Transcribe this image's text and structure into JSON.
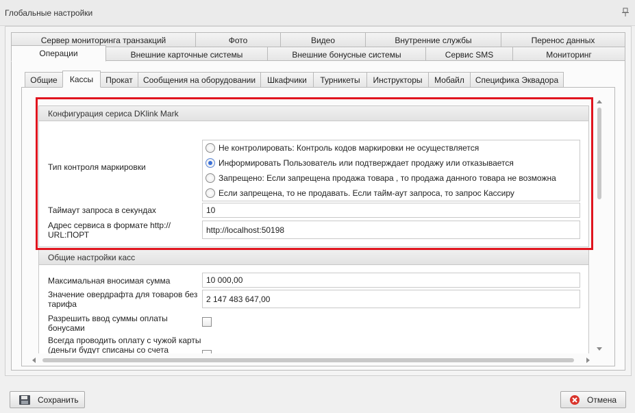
{
  "window": {
    "title": "Глобальные настройки",
    "pin_icon": "pin-icon"
  },
  "tabs_row1": [
    "Сервер мониторинга транзакций",
    "Фото",
    "Видео",
    "Внутренние службы",
    "Перенос данных"
  ],
  "tabs_row2": [
    "Операции",
    "Внешние карточные системы",
    "Внешние бонусные системы",
    "Сервис SMS",
    "Мониторинг"
  ],
  "tabs_row2_active": "Операции",
  "subtabs": [
    "Общие",
    "Кассы",
    "Прокат",
    "Сообщения на оборудовании",
    "Шкафчики",
    "Турникеты",
    "Инструкторы",
    "Мобайл",
    "Специфика Эквадора"
  ],
  "subtabs_active": "Кассы",
  "dklink": {
    "header": "Конфигурация сериса DKlink Mark",
    "control_type_label": "Тип контроля маркировки",
    "options": [
      "Не контролировать: Контроль кодов маркировки не  осуществляется",
      "Информировать Пользователь или подтверждает продажу или отказывается",
      "Запрещено: Если запрещена продажа товара , то продажа данного товара не возможна",
      "Если запрещена, то не продавать. Если тайм-аут запроса, то запрос Кассиру"
    ],
    "selected_option": "Информировать Пользователь или подтверждает продажу или отказывается",
    "timeout_label": "Таймаут запроса в секундах",
    "timeout_value": "10",
    "address_label_line1": "Адрес сервиса в формате http://",
    "address_label_line2": "URL:ПОРТ",
    "address_value": "http://localhost:50198"
  },
  "common": {
    "header": "Общие настройки касс",
    "max_sum_label": "Максимальная вносимая сумма",
    "max_sum_value": "10 000,00",
    "overdraft_label_line1": "Значение овердрафта для товаров без",
    "overdraft_label_line2": "тарифа",
    "overdraft_value": "2 147 483 647,00",
    "bonus_label_line1": "Разрешить ввод суммы оплаты",
    "bonus_label_line2": "бонусами",
    "bonus_checked": false,
    "foreign_card_label_line1": "Всегда проводить оплату с чужой карты",
    "foreign_card_label_line2": "(деньги будут списаны со счета",
    "foreign_card_checked": false
  },
  "buttons": {
    "save": "Сохранить",
    "cancel": "Отмена"
  },
  "colors": {
    "highlight": "#e0141e",
    "radio_accent": "#3a6fd8",
    "cancel_icon": "#d9342b"
  }
}
